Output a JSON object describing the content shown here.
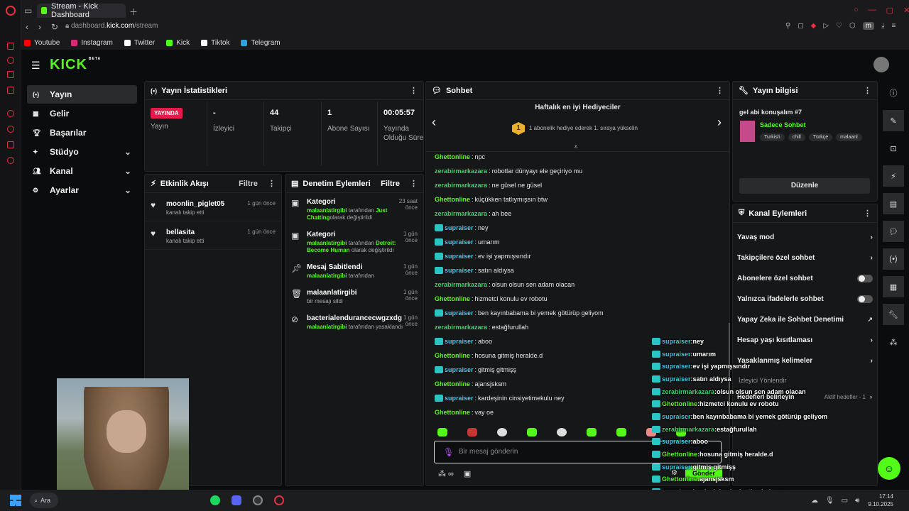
{
  "browser": {
    "tab_title": "Stream - Kick Dashboard",
    "url_prefix": "dashboard.",
    "url_domain": "kick.com",
    "url_path": "/stream",
    "profile_initial": "m",
    "bookmarks": [
      "Youtube",
      "Instagram",
      "Twitter",
      "Kick",
      "Tiktok",
      "Telegram"
    ]
  },
  "header": {
    "logo": "KICK",
    "beta": "BETA"
  },
  "sidebar": {
    "items": [
      {
        "label": "Yayın",
        "icon": "broadcast-icon",
        "active": true
      },
      {
        "label": "Gelir",
        "icon": "revenue-icon"
      },
      {
        "label": "Başarılar",
        "icon": "trophy-icon"
      },
      {
        "label": "Stüdyo",
        "icon": "studio-icon",
        "expandable": true
      },
      {
        "label": "Kanal",
        "icon": "channel-icon",
        "expandable": true
      },
      {
        "label": "Ayarlar",
        "icon": "settings-icon",
        "expandable": true
      }
    ]
  },
  "stats": {
    "title": "Yayın İstatistikleri",
    "live_badge": "YAYINDA",
    "items": [
      {
        "value": "",
        "label": "Yayın"
      },
      {
        "value": "-",
        "label": "İzleyici"
      },
      {
        "value": "44",
        "label": "Takipçi"
      },
      {
        "value": "1",
        "label": "Abone Sayısı"
      },
      {
        "value": "00:05:57",
        "label": "Yayında Olduğu Süre"
      }
    ]
  },
  "activity": {
    "title": "Etkinlik Akışı",
    "filter": "Filtre",
    "items": [
      {
        "user": "moonlin_piglet05",
        "action": "kanalı takip etti",
        "time": "1 gün önce"
      },
      {
        "user": "bellasita",
        "action": "kanalı takip etti",
        "time": "1 gün önce"
      }
    ]
  },
  "moderation": {
    "title": "Denetim Eylemleri",
    "filter": "Filtre",
    "items": [
      {
        "title": "Kategori",
        "time": "23 saat önce",
        "actor": "malaanlatirgibi",
        "mid": " tarafından ",
        "target": "Just Chatting",
        "tail": "olarak değiştirildi"
      },
      {
        "title": "Kategori",
        "time": "1 gün önce",
        "actor": "malaanlatirgibi",
        "mid": " tarafından ",
        "target": "Detroit: Become Human",
        "tail": " olarak değiştirildi"
      },
      {
        "title": "Mesaj Sabitlendi",
        "time": "1 gün önce",
        "actor": "malaanlatirgibi",
        "mid": " tarafından",
        "target": "",
        "tail": ""
      },
      {
        "title": "malaanlatirgibi",
        "time": "1 gün önce",
        "actor": "",
        "mid": "bir mesajı sildi",
        "target": "",
        "tail": ""
      },
      {
        "title": "bacterialendurancecwgzxdg",
        "time": "1 gün önce",
        "actor": "malaanlatirgibi",
        "mid": " tarafından yasaklandı",
        "target": "",
        "tail": ""
      }
    ]
  },
  "chat": {
    "title": "Sohbet",
    "gifters_title": "Haftalık en iyi Hediyeciler",
    "gifters_rank": "1",
    "gifters_sub": "1 abonelik hediye ederek 1. sıraya yükselin",
    "placeholder": "Bir mesaj gönderin",
    "send": "Gönder",
    "messages": [
      {
        "user": "Ghettonline",
        "text": "npc",
        "color": "#53fc18",
        "badge": false
      },
      {
        "user": "zerabirmarkazara",
        "text": "robotlar dünyayı ele geçiriyo mu",
        "color": "#3ad16b",
        "badge": false
      },
      {
        "user": "zerabirmarkazara",
        "text": "ne güsel ne güsel",
        "color": "#3ad16b",
        "badge": false
      },
      {
        "user": "Ghettonline",
        "text": "küçükken tatlıymışsın btw",
        "color": "#53fc18",
        "badge": false
      },
      {
        "user": "zerabirmarkazara",
        "text": "ah bee",
        "color": "#3ad16b",
        "badge": false
      },
      {
        "user": "supraiser",
        "text": "ney",
        "color": "#3bc8e8",
        "badge": true
      },
      {
        "user": "supraiser",
        "text": "umarım",
        "color": "#3bc8e8",
        "badge": true
      },
      {
        "user": "supraiser",
        "text": "ev işi yapmışsındır",
        "color": "#3bc8e8",
        "badge": true
      },
      {
        "user": "supraiser",
        "text": "satın aldıysa",
        "color": "#3bc8e8",
        "badge": true
      },
      {
        "user": "zerabirmarkazara",
        "text": "olsun olsun sen adam olacan",
        "color": "#3ad16b",
        "badge": false
      },
      {
        "user": "Ghettonline",
        "text": "hizmetci konulu ev robotu",
        "color": "#53fc18",
        "badge": false
      },
      {
        "user": "supraiser",
        "text": "ben kayınbabama bi yemek götürüp geliyom",
        "color": "#3bc8e8",
        "badge": true
      },
      {
        "user": "zerabirmarkazara",
        "text": "estağfurullah",
        "color": "#3ad16b",
        "badge": false
      },
      {
        "user": "supraiser",
        "text": "aboo",
        "color": "#3bc8e8",
        "badge": true
      },
      {
        "user": "Ghettonline",
        "text": "hosuna gitmiş heralde.d",
        "color": "#53fc18",
        "badge": false
      },
      {
        "user": "supraiser",
        "text": "gitmiş gitmişş",
        "color": "#3bc8e8",
        "badge": true
      },
      {
        "user": "Ghettonline",
        "text": "ajansjsksm",
        "color": "#53fc18",
        "badge": false
      },
      {
        "user": "supraiser",
        "text": "kardeşinin cinsiyetimekulu ney",
        "color": "#3bc8e8",
        "badge": true
      },
      {
        "user": "Ghettonline",
        "text": "vay oe",
        "color": "#53fc18",
        "badge": false
      }
    ]
  },
  "overlay": {
    "messages": [
      {
        "user": "supraiser",
        "text": "ney",
        "color": "#3bc8e8"
      },
      {
        "user": "supraiser",
        "text": "umarım",
        "color": "#3bc8e8"
      },
      {
        "user": "supraiser",
        "text": "ev işi yapmışsındır",
        "color": "#3bc8e8"
      },
      {
        "user": "supraiser",
        "text": "satın aldıysa",
        "color": "#3bc8e8"
      },
      {
        "user": "zerabirmarkazara",
        "text": "olsun olsun sen adam olacan",
        "color": "#3ad16b"
      },
      {
        "user": "Ghettonline",
        "text": "hizmetci konulu ev robotu",
        "color": "#53fc18"
      },
      {
        "user": "supraiser",
        "text": "ben kayınbabama bi yemek götürüp geliyom",
        "color": "#3bc8e8"
      },
      {
        "user": "zerabirmarkazara",
        "text": "estağfurullah",
        "color": "#3ad16b"
      },
      {
        "user": "supraiser",
        "text": "aboo",
        "color": "#3bc8e8"
      },
      {
        "user": "Ghettonline",
        "text": "hosuna gitmiş heralde.d",
        "color": "#53fc18"
      },
      {
        "user": "supraiser",
        "text": "gitmiş gitmişş",
        "color": "#3bc8e8"
      },
      {
        "user": "Ghettonline",
        "text": "ajansjsksm",
        "color": "#53fc18"
      },
      {
        "user": "supraiser",
        "text": "kardeşinin cinsiyetimekulu ney",
        "color": "#3bc8e8"
      },
      {
        "user": "Ghettonline",
        "text": "vay oe",
        "color": "#53fc18"
      }
    ]
  },
  "stream_info": {
    "title": "Yayın bilgisi",
    "stream_title": "gel abi konuşalım #7",
    "category": "Sadece Sohbet",
    "tags": [
      "Turkish",
      "chill",
      "Türkçe",
      "malaanl"
    ],
    "edit": "Düzenle"
  },
  "channel_actions": {
    "title": "Kanal Eylemleri",
    "items": [
      {
        "label": "Yavaş mod",
        "kind": "chevron"
      },
      {
        "label": "Takipçilere özel sohbet",
        "kind": "chevron"
      },
      {
        "label": "Abonelere özel sohbet",
        "kind": "toggle"
      },
      {
        "label": "Yalnızca ifadelerle sohbet",
        "kind": "toggle"
      },
      {
        "label": "Yapay Zeka ile Sohbet Denetimi",
        "kind": "external"
      },
      {
        "label": "Hesap yaşı kısıtlaması",
        "kind": "chevron"
      },
      {
        "label": "Yasaklanmış kelimeler",
        "kind": "chevron"
      }
    ],
    "viewer_dir": "İzleyici Yönlendir",
    "goals": "Hedefleri belirleyin",
    "goals_active": "Aktif hedefler - 1"
  },
  "taskbar": {
    "search": "Ara",
    "time": "17:14",
    "date": "9.10.2025"
  },
  "colors": {
    "accent": "#53fc18",
    "live": "#e6194b"
  }
}
